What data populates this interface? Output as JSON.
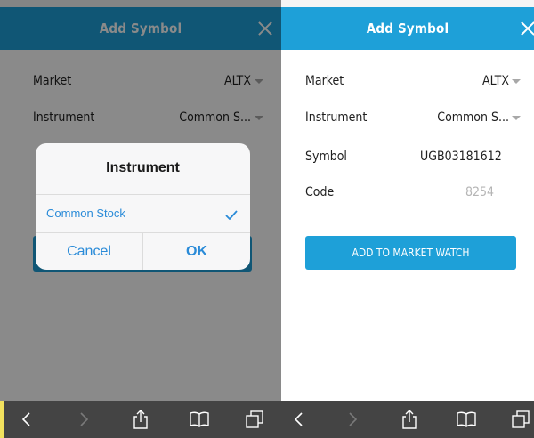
{
  "left": {
    "header": {
      "title": "Add Symbol"
    },
    "rows": [
      {
        "label": "Market",
        "value": "ALTX"
      },
      {
        "label": "Instrument",
        "value": "Common S..."
      }
    ],
    "dialog": {
      "title": "Instrument",
      "options": [
        {
          "label": "Common Stock",
          "selected": true
        }
      ],
      "cancel_label": "Cancel",
      "ok_label": "OK"
    }
  },
  "right": {
    "header": {
      "title": "Add Symbol"
    },
    "rows": [
      {
        "label": "Market",
        "value": "ALTX"
      },
      {
        "label": "Instrument",
        "value": "Common S..."
      },
      {
        "label": "Symbol",
        "value": "UGB03181612"
      },
      {
        "label": "Code",
        "value": "8254"
      }
    ],
    "add_button_label": "ADD TO MARKET WATCH"
  },
  "toolbar": {
    "icons": [
      "back-icon",
      "forward-icon",
      "share-icon",
      "bookmarks-icon",
      "tabs-icon"
    ]
  },
  "colors": {
    "accent": "#1ea0d8",
    "toolbar": "#444444",
    "dialog_text": "#2a8bd8"
  }
}
